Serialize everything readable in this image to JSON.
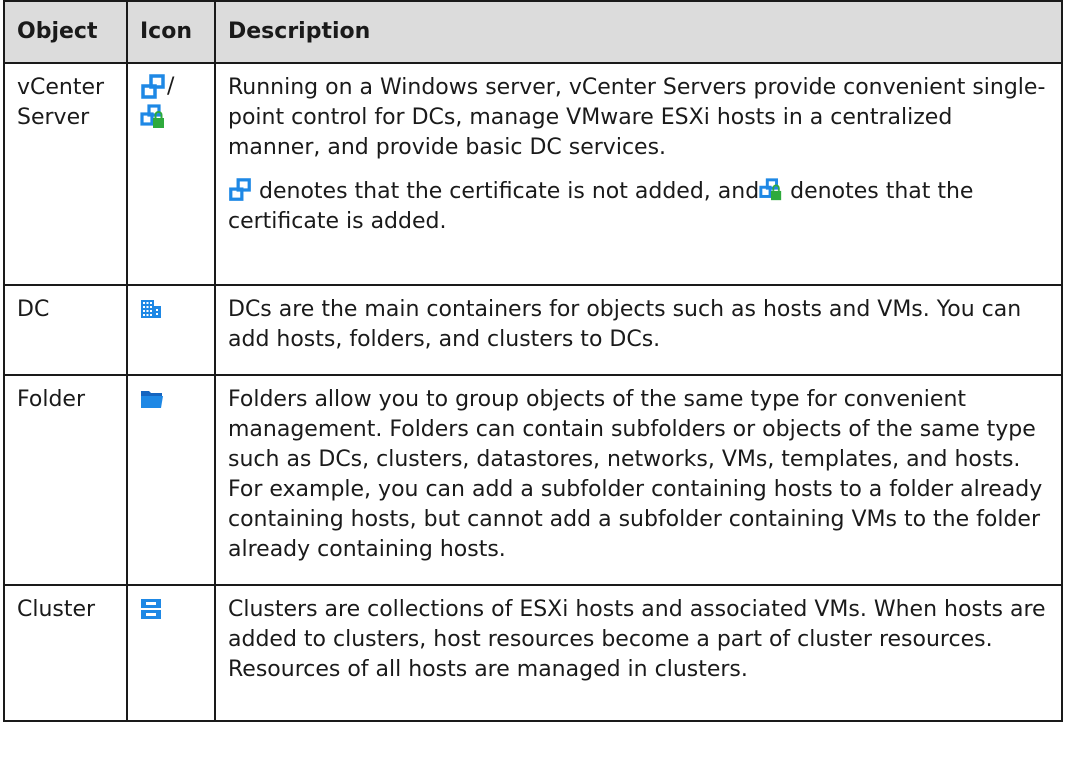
{
  "table": {
    "headers": {
      "object": "Object",
      "icon": "Icon",
      "description": "Description"
    },
    "rows": [
      {
        "object": "vCenter Server",
        "icons": [
          "vcenter-icon",
          "vcenter-certified-icon"
        ],
        "icon_separator": "/",
        "description_p1": "Running on a Windows server, vCenter Servers provide convenient single-point control for DCs, manage VMware ESXi hosts in a centralized manner, and provide basic DC services.",
        "description_p2_a": "denotes that the certificate is not added, and",
        "description_p2_b": "denotes that the certificate is added."
      },
      {
        "object": "DC",
        "icons": [
          "datacenter-icon"
        ],
        "description_p1": "DCs are the main containers for objects such as hosts and VMs. You can add hosts, folders, and clusters to DCs."
      },
      {
        "object": "Folder",
        "icons": [
          "folder-icon"
        ],
        "description_p1": "Folders allow you to group objects of the same type for convenient management. Folders can contain subfolders or objects of the same type such as DCs, clusters, datastores, networks, VMs, templates, and hosts. For example, you can add a subfolder containing hosts to a folder already containing hosts, but cannot add a subfolder containing VMs to the folder already containing hosts."
      },
      {
        "object": "Cluster",
        "icons": [
          "cluster-icon"
        ],
        "description_p1": "Clusters are collections of ESXi hosts and associated VMs. When hosts are added to clusters, host resources become a part of cluster resources. Resources of all hosts are managed in clusters."
      }
    ]
  },
  "colors": {
    "header_bg": "#dcdcdc",
    "border": "#1a1a1a",
    "icon_blue": "#1e88e5",
    "lock_green": "#2eaa3c"
  }
}
